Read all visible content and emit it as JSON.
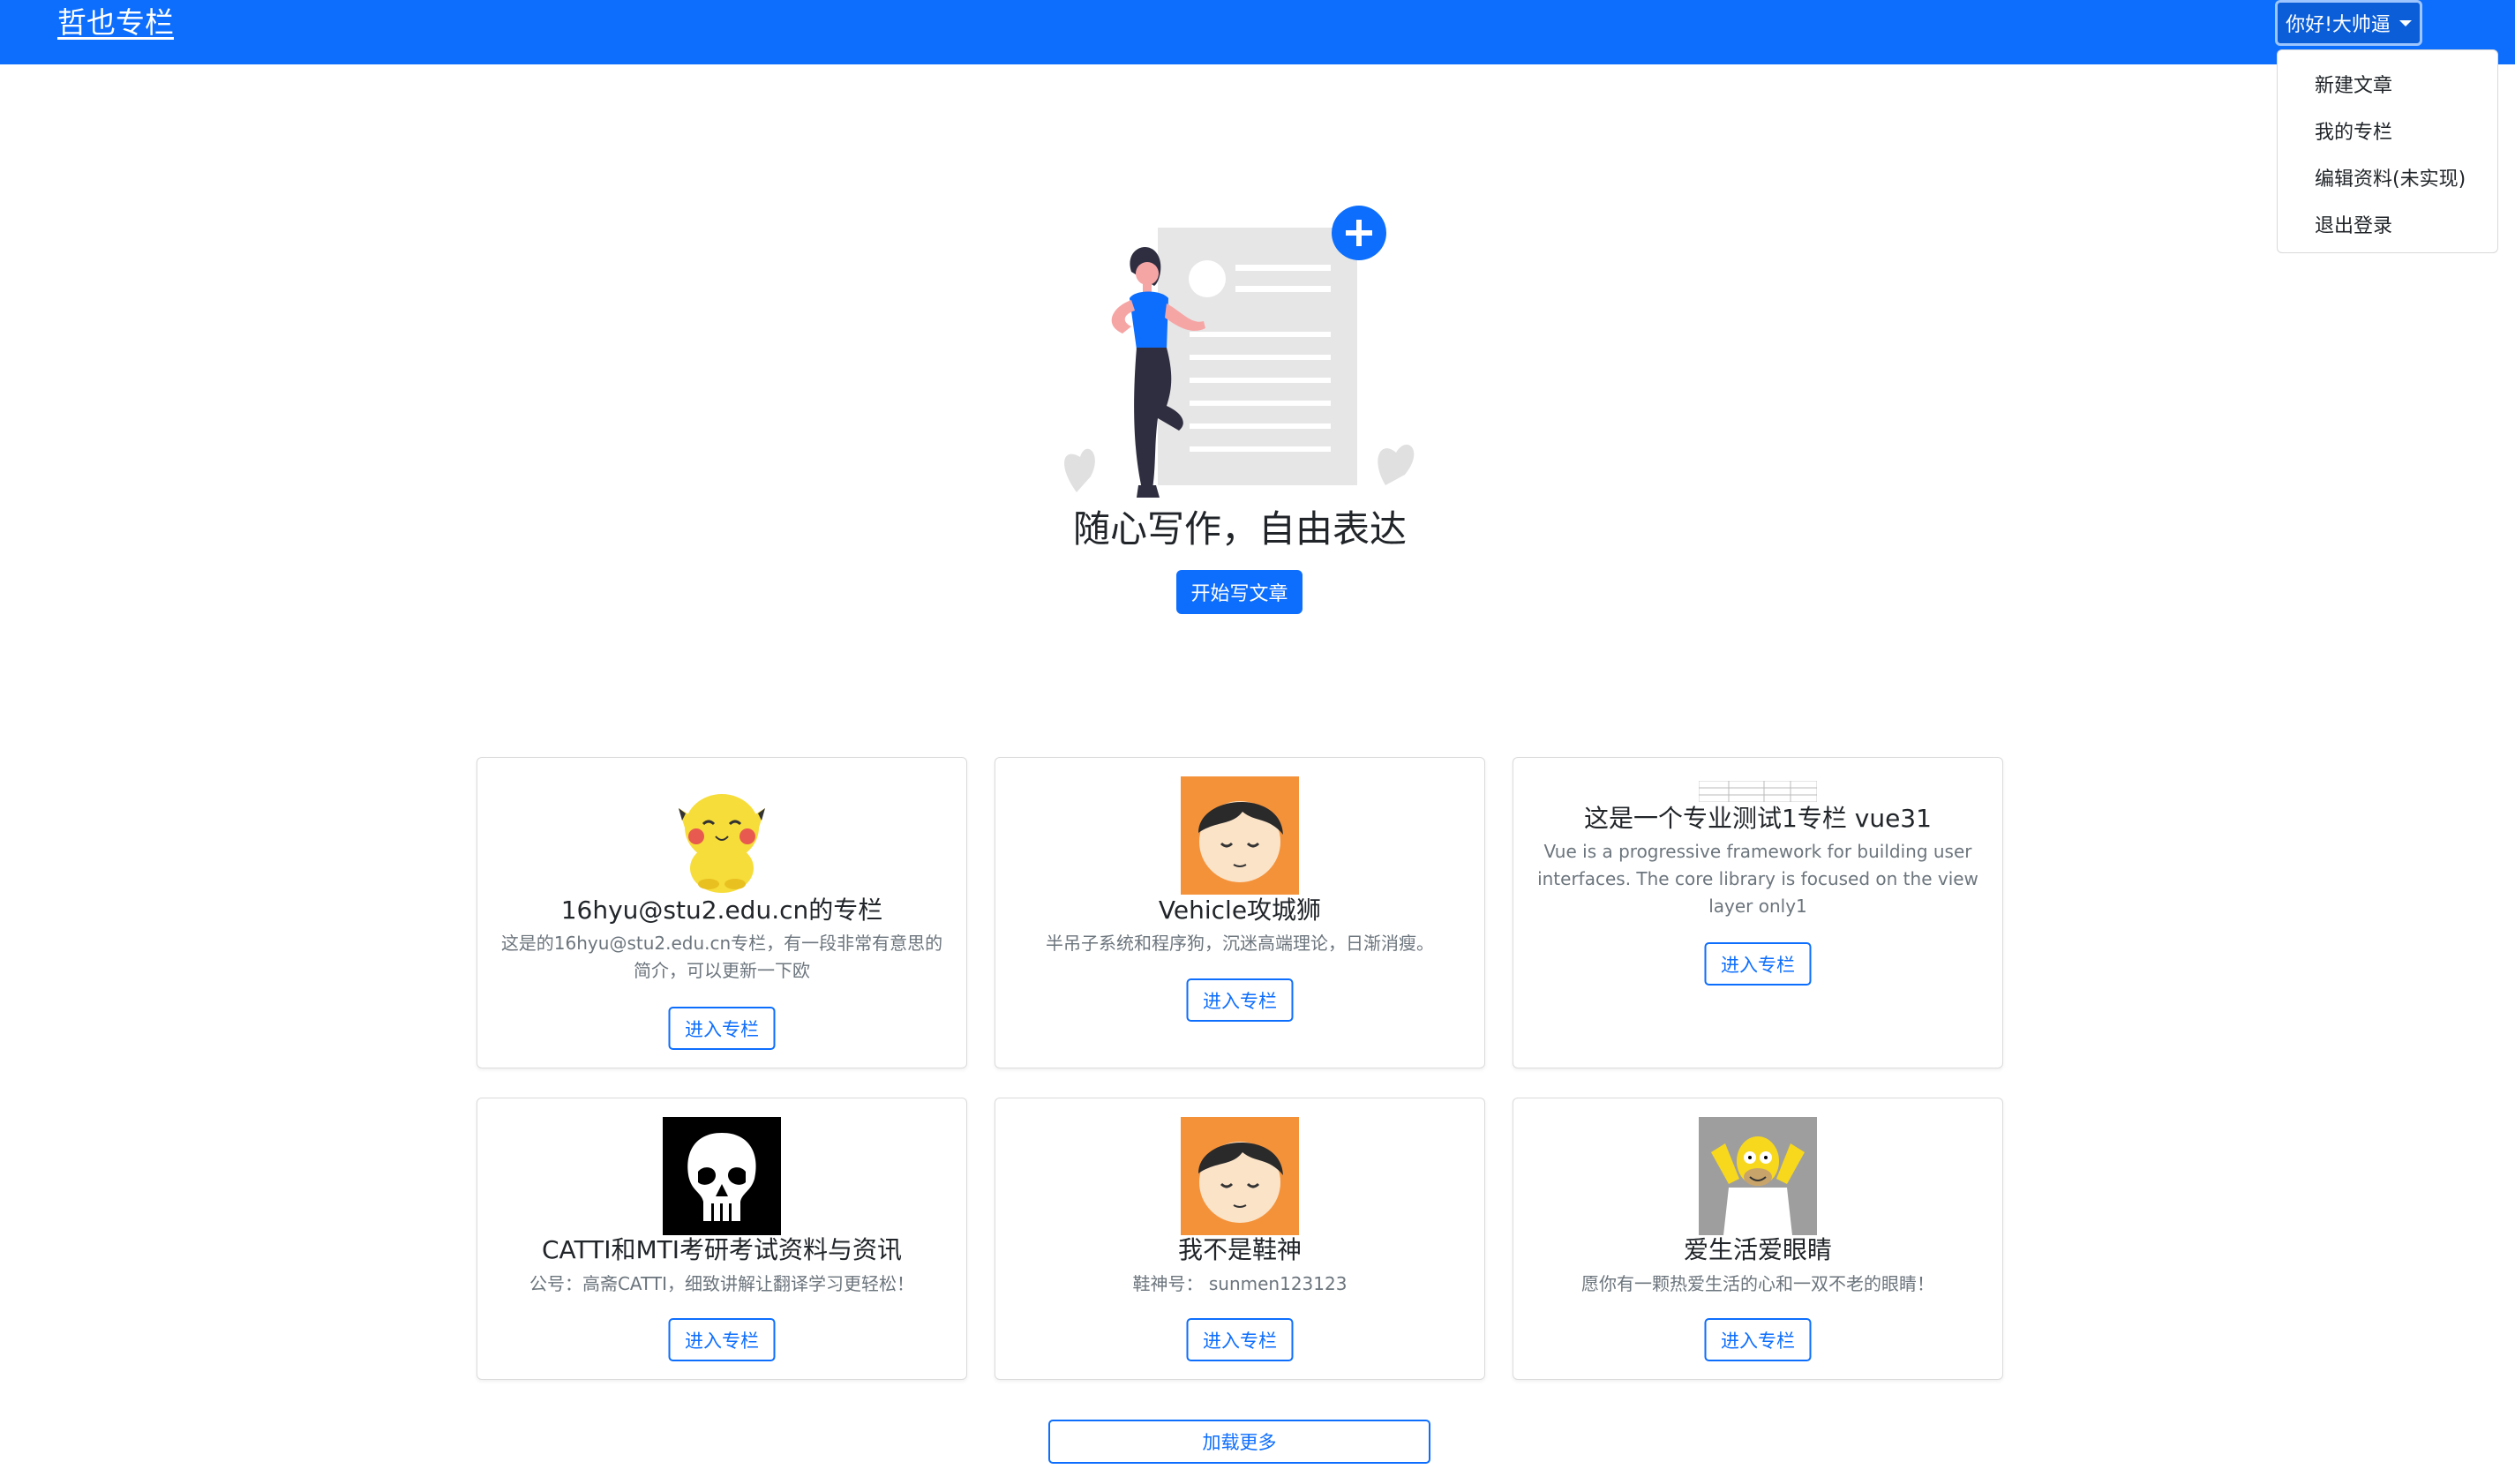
{
  "navbar": {
    "brand": "哲也专栏",
    "user_greeting": "你好!大帅逼",
    "bg_color": "#0d6efd"
  },
  "dropdown": {
    "items": [
      {
        "label": "新建文章"
      },
      {
        "label": "我的专栏"
      },
      {
        "label": "编辑资料(未实现)"
      },
      {
        "label": "退出登录"
      }
    ]
  },
  "hero": {
    "title": "随心写作，自由表达",
    "cta": "开始写文章",
    "illustration_icon": "writing-woman-illustration"
  },
  "columns": [
    {
      "title": "16hyu@stu2.edu.cn的专栏",
      "description": "这是的16hyu@stu2.edu.cn专栏，有一段非常有意思的简介，可以更新一下欧",
      "button": "进入专栏",
      "avatar": "pikachu-avatar"
    },
    {
      "title": "Vehicle攻城狮",
      "description": "半吊子系统和程序狗，沉迷高端理论，日渐消瘦。",
      "button": "进入专栏",
      "avatar": "cartoon-face-avatar"
    },
    {
      "title": "这是一个专业测试1专栏 vue31",
      "description": "Vue is a progressive framework for building user interfaces. The core library is focused on the view layer only1",
      "button": "进入专栏",
      "avatar": "document-thumbnail-avatar"
    },
    {
      "title": "CATTI和MTI考研考试资料与资讯",
      "description": "公号：高斋CATTI，细致讲解让翻译学习更轻松！",
      "button": "进入专栏",
      "avatar": "skull-avatar"
    },
    {
      "title": "我不是鞋神",
      "description": "鞋神号： sunmen123123",
      "button": "进入专栏",
      "avatar": "cartoon-face-avatar"
    },
    {
      "title": "爱生活爱眼睛",
      "description": "愿你有一颗热爱生活的心和一双不老的眼睛！",
      "button": "进入专栏",
      "avatar": "homer-avatar"
    }
  ],
  "load_more": "加载更多"
}
